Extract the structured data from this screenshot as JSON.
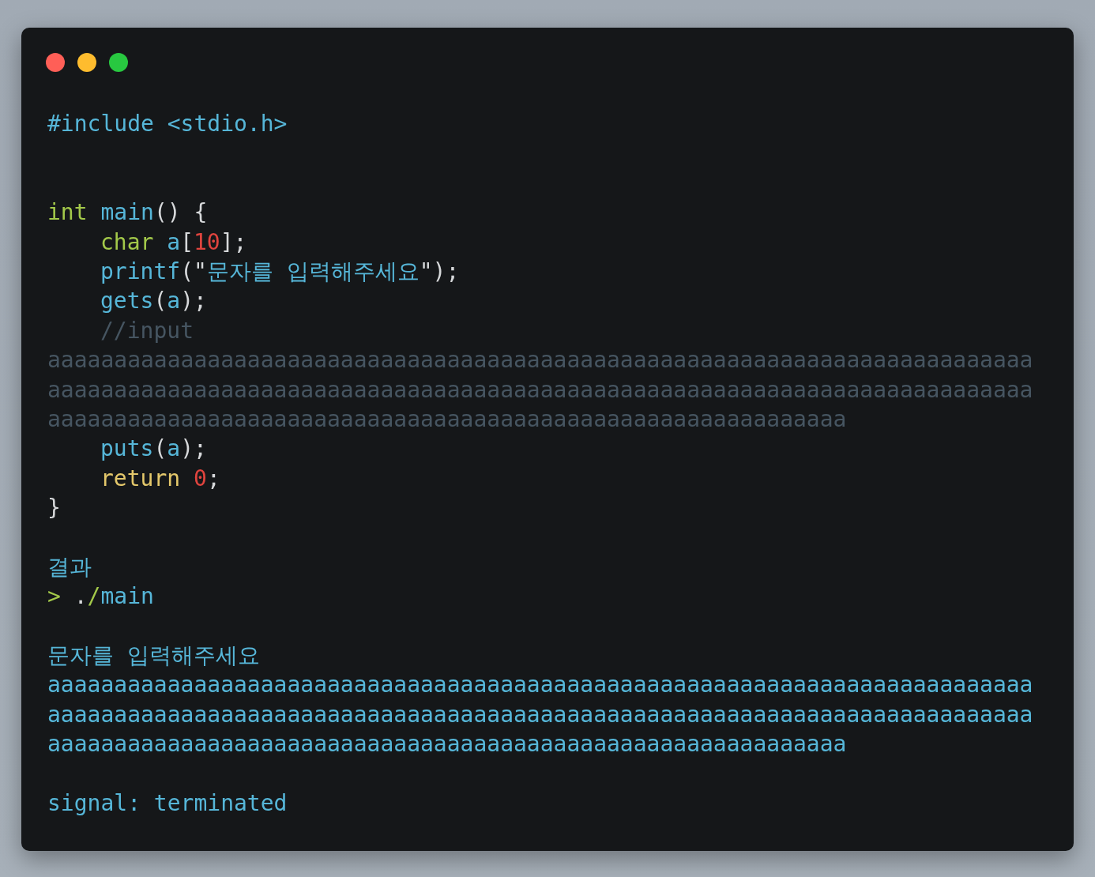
{
  "window": {
    "controls": [
      {
        "kind": "close"
      },
      {
        "kind": "minimize"
      },
      {
        "kind": "zoom"
      }
    ]
  },
  "code_lines": [
    {
      "kind": "code",
      "indented": false,
      "tokens": [
        {
          "text": "#include <stdio.h>",
          "kind": "name"
        }
      ]
    },
    {
      "kind": "blank"
    },
    {
      "kind": "blank"
    },
    {
      "kind": "code",
      "indented": false,
      "tokens": [
        {
          "text": "int",
          "kind": "type"
        },
        {
          "text": " main",
          "kind": "name"
        },
        {
          "text": "() {",
          "kind": "plain"
        }
      ]
    },
    {
      "kind": "code",
      "indented": true,
      "tokens": [
        {
          "text": "char",
          "kind": "type"
        },
        {
          "text": " a",
          "kind": "name"
        },
        {
          "text": "[",
          "kind": "plain"
        },
        {
          "text": "10",
          "kind": "number"
        },
        {
          "text": "];",
          "kind": "plain"
        }
      ]
    },
    {
      "kind": "code",
      "indented": true,
      "tokens": [
        {
          "text": "printf",
          "kind": "name"
        },
        {
          "text": "(",
          "kind": "plain"
        },
        {
          "text": "\"",
          "kind": "plain"
        },
        {
          "text": "문자를 입력해주세요",
          "kind": "name"
        },
        {
          "text": "\");",
          "kind": "plain"
        }
      ]
    },
    {
      "kind": "code",
      "indented": true,
      "tokens": [
        {
          "text": "gets",
          "kind": "name"
        },
        {
          "text": "(",
          "kind": "plain"
        },
        {
          "text": "a",
          "kind": "name"
        },
        {
          "text": ");",
          "kind": "plain"
        }
      ]
    },
    {
      "kind": "code",
      "indented": true,
      "tokens": [
        {
          "text": "//input",
          "kind": "comment"
        }
      ]
    },
    {
      "kind": "code",
      "indented": false,
      "tokens": [
        {
          "text": "aaaaaaaaaaaaaaaaaaaaaaaaaaaaaaaaaaaaaaaaaaaaaaaaaaaaaaaaaaaaaaaaaaaaaaaaaa",
          "kind": "comment"
        }
      ]
    },
    {
      "kind": "code",
      "indented": false,
      "tokens": [
        {
          "text": "aaaaaaaaaaaaaaaaaaaaaaaaaaaaaaaaaaaaaaaaaaaaaaaaaaaaaaaaaaaaaaaaaaaaaaaaaa",
          "kind": "comment"
        }
      ]
    },
    {
      "kind": "code",
      "indented": false,
      "tokens": [
        {
          "text": "aaaaaaaaaaaaaaaaaaaaaaaaaaaaaaaaaaaaaaaaaaaaaaaaaaaaaaaaaaaa",
          "kind": "comment"
        }
      ]
    },
    {
      "kind": "code",
      "indented": true,
      "tokens": [
        {
          "text": "puts",
          "kind": "name"
        },
        {
          "text": "(",
          "kind": "plain"
        },
        {
          "text": "a",
          "kind": "name"
        },
        {
          "text": ");",
          "kind": "plain"
        }
      ]
    },
    {
      "kind": "code",
      "indented": true,
      "tokens": [
        {
          "text": "return",
          "kind": "control"
        },
        {
          "text": " 0",
          "kind": "number"
        },
        {
          "text": ";",
          "kind": "plain"
        }
      ]
    },
    {
      "kind": "code",
      "indented": false,
      "tokens": [
        {
          "text": "}",
          "kind": "plain"
        }
      ]
    },
    {
      "kind": "blank"
    },
    {
      "kind": "code",
      "indented": false,
      "tokens": [
        {
          "text": "결과",
          "kind": "name"
        }
      ]
    },
    {
      "kind": "code",
      "indented": false,
      "tokens": [
        {
          "text": ">",
          "kind": "type"
        },
        {
          "text": " .",
          "kind": "plain"
        },
        {
          "text": "/",
          "kind": "type"
        },
        {
          "text": "main",
          "kind": "name"
        }
      ]
    },
    {
      "kind": "blank"
    },
    {
      "kind": "code",
      "indented": false,
      "tokens": [
        {
          "text": "문자를 입력해주세요",
          "kind": "name"
        }
      ]
    },
    {
      "kind": "code",
      "indented": false,
      "tokens": [
        {
          "text": "aaaaaaaaaaaaaaaaaaaaaaaaaaaaaaaaaaaaaaaaaaaaaaaaaaaaaaaaaaaaaaaaaaaaaaaaaa",
          "kind": "name"
        }
      ]
    },
    {
      "kind": "code",
      "indented": false,
      "tokens": [
        {
          "text": "aaaaaaaaaaaaaaaaaaaaaaaaaaaaaaaaaaaaaaaaaaaaaaaaaaaaaaaaaaaaaaaaaaaaaaaaaa",
          "kind": "name"
        }
      ]
    },
    {
      "kind": "code",
      "indented": false,
      "tokens": [
        {
          "text": "aaaaaaaaaaaaaaaaaaaaaaaaaaaaaaaaaaaaaaaaaaaaaaaaaaaaaaaaaaaa",
          "kind": "name"
        }
      ]
    },
    {
      "kind": "blank"
    },
    {
      "kind": "code",
      "indented": false,
      "tokens": [
        {
          "text": "signal: terminated",
          "kind": "name"
        }
      ]
    }
  ]
}
